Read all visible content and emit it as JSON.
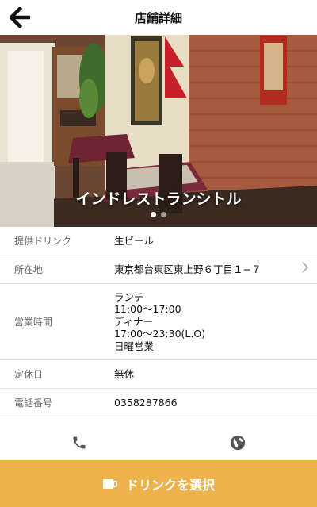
{
  "header": {
    "title": "店舗詳細",
    "back_icon": "arrow-left-icon"
  },
  "hero": {
    "name": "インドレストランシトル",
    "slide_count": 2,
    "active_slide": 1
  },
  "info": {
    "drink": {
      "label": "提供ドリンク",
      "value": "生ビール"
    },
    "address": {
      "label": "所在地",
      "value": "東京都台東区東上野６丁目１−７",
      "chevron_icon": "chevron-right-icon"
    },
    "hours": {
      "label": "営業時間",
      "lines": [
        "ランチ",
        "11:00〜17:00",
        "ディナー",
        "17:00〜23:30(L.O)",
        "日曜営業"
      ]
    },
    "holiday": {
      "label": "定休日",
      "value": "無休"
    },
    "phone": {
      "label": "電話番号",
      "value": "0358287866"
    }
  },
  "actions": {
    "call_icon": "phone-icon",
    "web_icon": "globe-icon"
  },
  "cta": {
    "label": "ドリンクを選択",
    "icon": "drink-ticket-icon",
    "color": "#edb24b"
  }
}
